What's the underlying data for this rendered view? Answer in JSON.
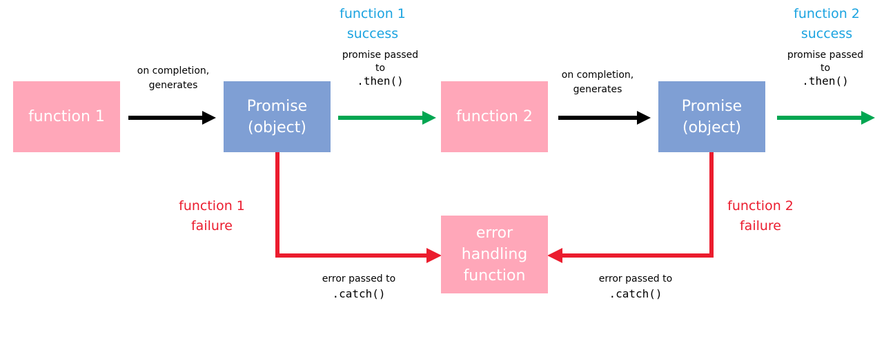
{
  "colors": {
    "function_box": "#FFA7B9",
    "promise_box": "#7F9FD4",
    "box_text": "#FFFFFF",
    "success_arrow": "#00A651",
    "generate_arrow": "#000000",
    "failure_arrow": "#EB1C2E",
    "success_text": "#1AA3E0",
    "failure_text": "#EB1C2E"
  },
  "nodes": {
    "function1": "function 1",
    "promise1_line1": "Promise",
    "promise1_line2": "(object)",
    "function2": "function 2",
    "promise2_line1": "Promise",
    "promise2_line2": "(object)",
    "error_handler_line1": "error",
    "error_handler_line2": "handling",
    "error_handler_line3": "function"
  },
  "edges": {
    "gen1_line1": "on completion,",
    "gen1_line2": "generates",
    "gen2_line1": "on completion,",
    "gen2_line2": "generates",
    "then1_line1": "promise passed",
    "then1_line2": "to",
    "then1_code": ".then()",
    "then2_line1": "promise passed",
    "then2_line2": "to",
    "then2_code": ".then()",
    "catch1_line1": "error passed to",
    "catch1_code": ".catch()",
    "catch2_line1": "error passed to",
    "catch2_code": ".catch()"
  },
  "annotations": {
    "success1_line1": "function 1",
    "success1_line2": "success",
    "success2_line1": "function 2",
    "success2_line2": "success",
    "failure1_line1": "function 1",
    "failure1_line2": "failure",
    "failure2_line1": "function 2",
    "failure2_line2": "failure"
  }
}
